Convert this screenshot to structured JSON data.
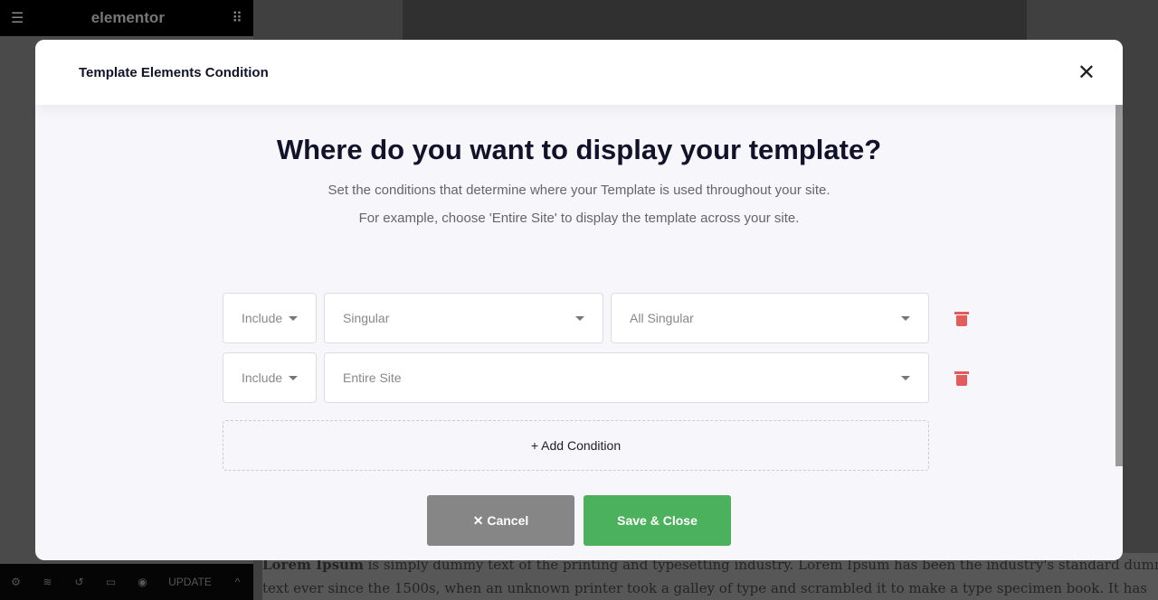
{
  "editor": {
    "logo": "elementor",
    "update_label": "UPDATE"
  },
  "page_text": {
    "bold": "Lorem Ipsum",
    "line1": " is simply dummy text of the printing and typesetting industry. Lorem Ipsum has been the industry's standard dummy",
    "line2": "text ever since the 1500s, when an unknown printer took a galley of type and scrambled it to make a type specimen book. It has"
  },
  "modal": {
    "title": "Template Elements Condition",
    "heading": "Where do you want to display your template?",
    "subtitle1": "Set the conditions that determine where your Template is used throughout your site.",
    "subtitle2": "For example, choose 'Entire Site' to display the template across your site.",
    "conditions": [
      {
        "type": "Include",
        "target": "Singular",
        "sub": "All Singular"
      },
      {
        "type": "Include",
        "target": "Entire Site"
      }
    ],
    "add_label": "+ Add Condition",
    "cancel_label": "✕ Cancel",
    "save_label": "Save & Close"
  },
  "colors": {
    "save": "#4cb15c",
    "cancel": "#868686",
    "delete": "#e45b5b"
  }
}
